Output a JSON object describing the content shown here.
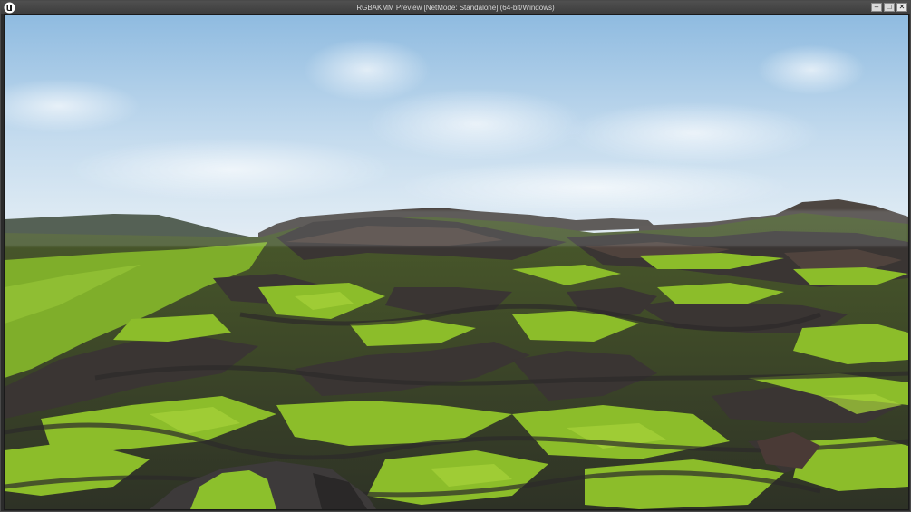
{
  "window": {
    "title": "RGBAKMM Preview [NetMode: Standalone]  (64-bit/Windows)",
    "controls": {
      "minimize": "–",
      "maximize": "□",
      "close": "✕"
    }
  },
  "icons": {
    "logo": "unreal-engine-logo-icon"
  },
  "colors": {
    "sky_top": "#9cc3e3",
    "sky_bottom": "#dce9f3",
    "grass": "#8fbf2c",
    "rock": "#3b3838"
  }
}
